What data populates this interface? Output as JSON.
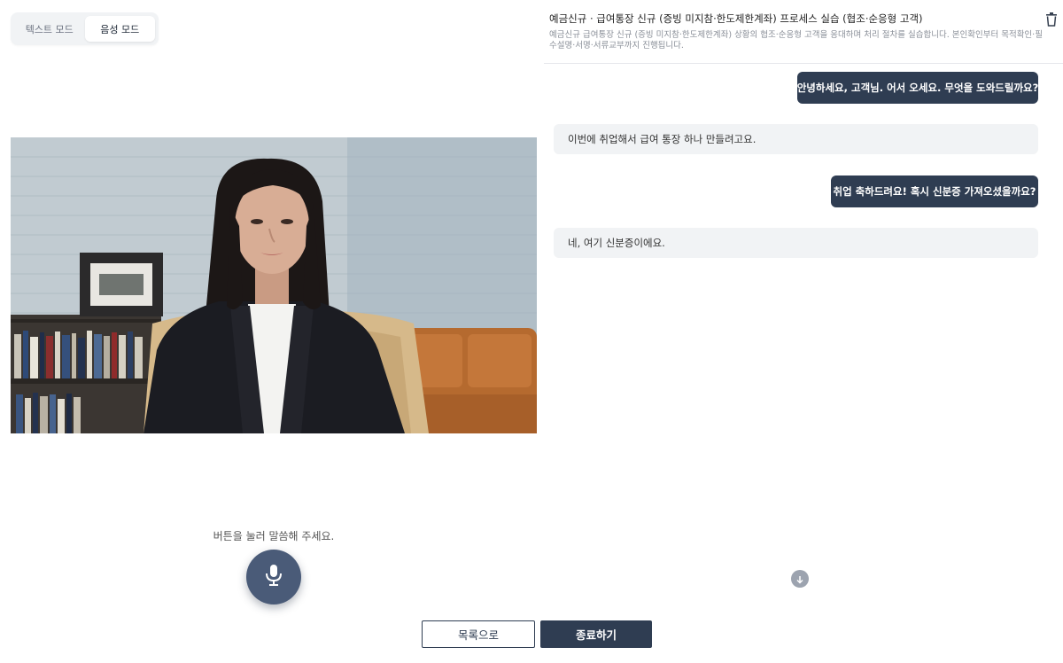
{
  "mode_toggle": {
    "text_mode": "텍스트 모드",
    "voice_mode": "음성 모드",
    "active": "voice_mode"
  },
  "voice": {
    "hint": "버튼을 눌러 말씀해 주세요.",
    "mic_icon": "microphone-icon"
  },
  "panel": {
    "title": "예금신규 · 급여통장 신규 (증빙 미지참·한도제한계좌) 프로세스 실습 (협조·순응형 고객)",
    "description": "예금신규 급여통장 신규 (증빙 미지참·한도제한계좌) 상황의 협조·순응형 고객을 응대하며 처리 절차를 실습합니다. 본인확인부터 목적확인·필수설명·서명·서류교부까지 진행됩니다.",
    "delete_icon": "trash-icon"
  },
  "messages": [
    {
      "role": "agent",
      "text": "안녕하세요, 고객님. 어서 오세요. 무엇을 도와드릴까요?"
    },
    {
      "role": "user",
      "text": "이번에 취업해서 급여 통장 하나 만들려고요."
    },
    {
      "role": "agent",
      "text": "취업 축하드려요! 혹시 신분증 가져오셨을까요?"
    },
    {
      "role": "user",
      "text": "네, 여기 신분증이에요."
    }
  ],
  "actions": {
    "list_label": "목록으로",
    "end_label": "종료하기"
  },
  "colors": {
    "primary": "#2f3d52",
    "mic": "#4a5b78",
    "user_bubble": "#f1f3f5"
  }
}
